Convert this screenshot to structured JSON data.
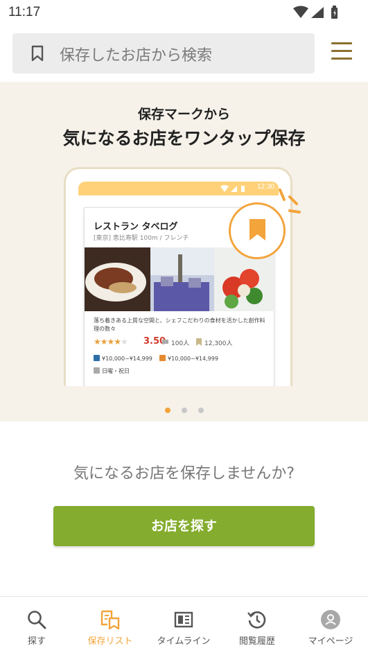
{
  "status_bar": {
    "time": "11:17"
  },
  "search": {
    "placeholder": "保存したお店から検索"
  },
  "promo": {
    "subtitle": "保存マークから",
    "title": "気になるお店をワンタップ保存",
    "phone_time": "12:30",
    "card": {
      "name": "レストラン タベログ",
      "meta": "[東京] 恵比寿駅 100m / フレンチ",
      "description": "落ち着きある上質な空間と、シェフこだわりの食材を活かした創作料理の数々",
      "rating": "3.50",
      "rating_fraction": 0.7,
      "reviews": "100人",
      "saves": "12,300人",
      "dinner_price": "¥10,000~¥14,999",
      "lunch_price": "¥10,000~¥14,999",
      "holiday": "日曜・祝日"
    },
    "carousel": {
      "total": 3,
      "active_index": 0
    }
  },
  "prompt": "気になるお店を保存しませんか?",
  "cta_label": "お店を探す",
  "nav": {
    "items": [
      {
        "label": "探す",
        "icon": "search-icon"
      },
      {
        "label": "保存リスト",
        "icon": "saved-list-icon",
        "active": true
      },
      {
        "label": "タイムライン",
        "icon": "timeline-icon"
      },
      {
        "label": "閲覧履歴",
        "icon": "history-icon"
      },
      {
        "label": "マイページ",
        "icon": "avatar-icon"
      }
    ]
  },
  "colors": {
    "accent": "#f3a43b",
    "cta": "#84ac2e",
    "promo_bg": "#f6f2ea"
  }
}
